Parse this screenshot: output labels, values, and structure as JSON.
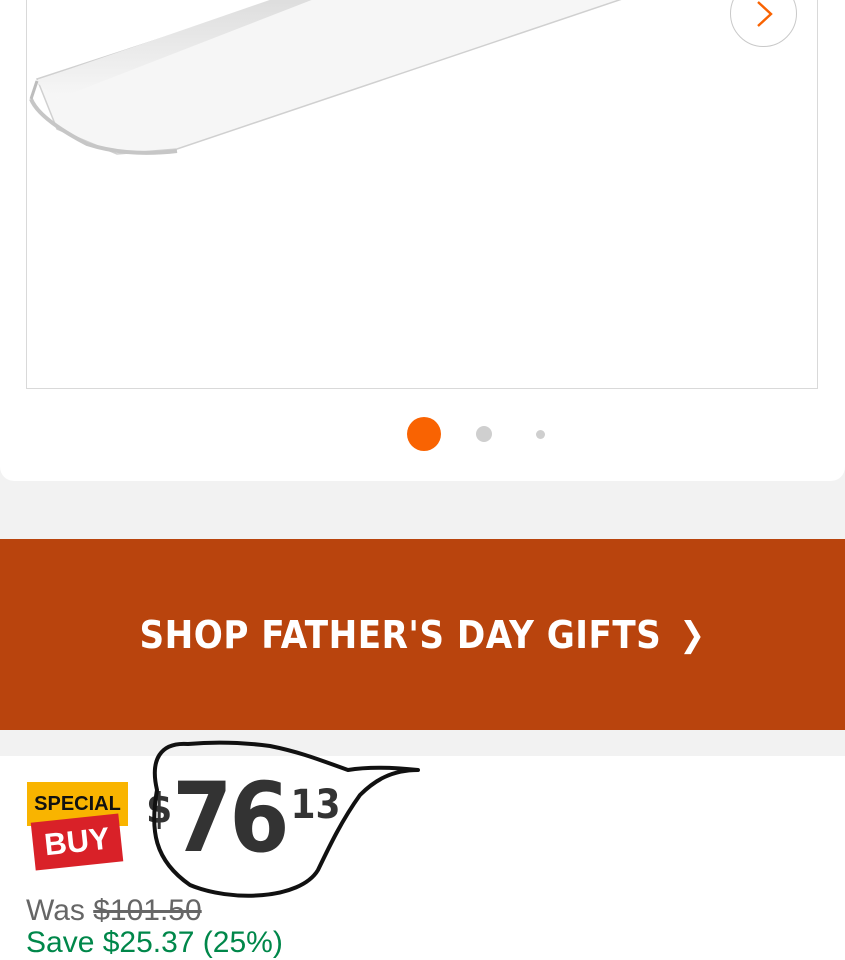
{
  "gallery": {
    "next_icon": "chevron-right-icon",
    "dots": [
      "active",
      "inactive",
      "inactive"
    ]
  },
  "promo": {
    "label": "SHOP FATHER'S DAY GIFTS",
    "chevron": "❯",
    "color": "#b9440d"
  },
  "pricing": {
    "badge_top": "SPECIAL",
    "badge_bottom": "BUY",
    "currency": "$",
    "dollars": "76",
    "cents": "13",
    "was_label": "Was ",
    "was_price": "$101.50",
    "save_text": "Save $25.37 (25%)"
  },
  "colors": {
    "accent": "#f96302",
    "save_green": "#00874a",
    "badge_yellow": "#f9b400",
    "badge_red": "#d92128"
  }
}
